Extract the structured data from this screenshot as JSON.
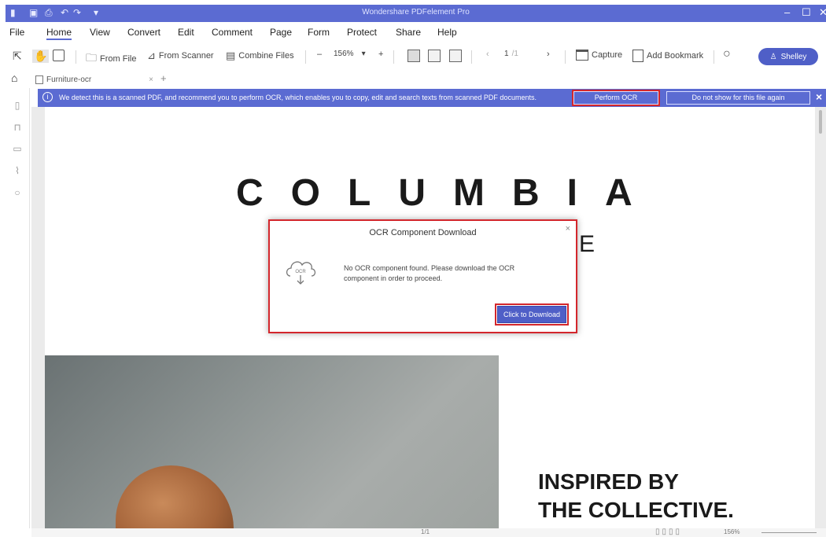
{
  "window": {
    "title": "Wondershare PDFelement Pro",
    "controls": [
      "–",
      "☐",
      "✕"
    ]
  },
  "menu": {
    "items": [
      "File",
      "Home",
      "View",
      "Convert",
      "Edit",
      "Comment",
      "Page",
      "Form",
      "Protect",
      "Share",
      "Help"
    ],
    "active": "Home"
  },
  "toolbar": {
    "from_file": "From File",
    "from_scanner": "From Scanner",
    "combine_files": "Combine Files",
    "zoom": "156%",
    "zoom_minus": "–",
    "zoom_plus": "+",
    "page_current": "1",
    "page_total": "/1",
    "capture": "Capture",
    "add_bookmark": "Add Bookmark",
    "user": "Shelley"
  },
  "tabs": {
    "document": "Furniture-ocr",
    "add": "+"
  },
  "banner": {
    "message": "We detect this is a scanned PDF, and recommend you to perform OCR, which enables you to copy, edit and search texts from scanned PDF documents.",
    "perform_ocr": "Perform OCR",
    "do_not_show": "Do not show for this file again"
  },
  "document": {
    "brand": "COLUMBIA",
    "brand_line2_visible": "E",
    "headline_1": "INSPIRED BY",
    "headline_2": "THE COLLECTIVE."
  },
  "dialog": {
    "title": "OCR Component Download",
    "icon_label": "OCR",
    "message": "No OCR component found. Please download the OCR component in order to proceed.",
    "button": "Click to Download"
  },
  "statusbar": {
    "page": "1/1",
    "zoom": "156%"
  },
  "colors": {
    "accent": "#5b6bd2",
    "button": "#4f5fc7",
    "highlight": "#d3262c"
  }
}
